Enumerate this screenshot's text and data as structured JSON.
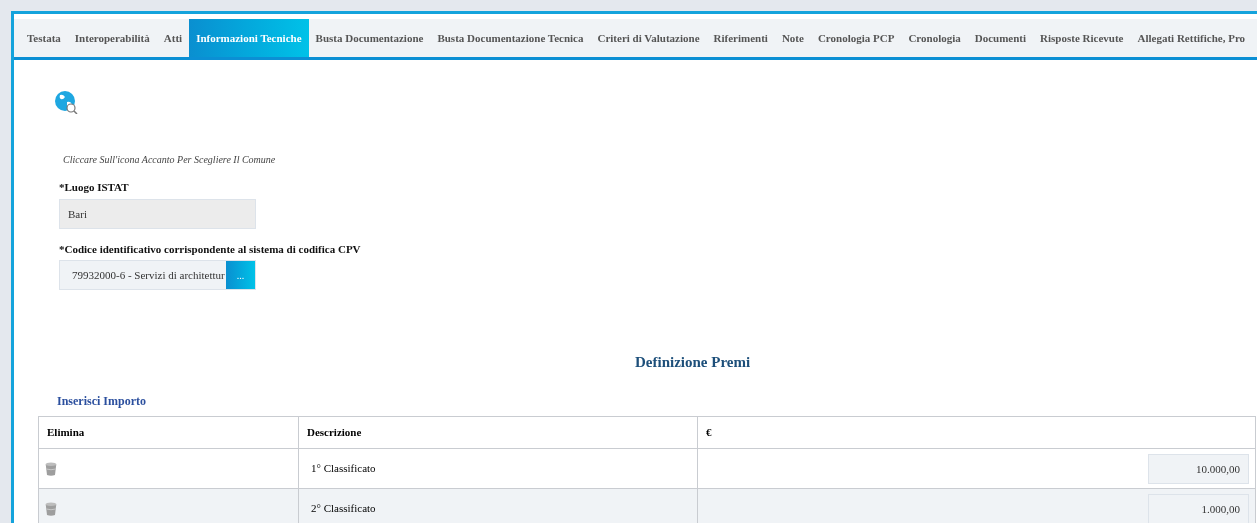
{
  "tabs": [
    {
      "label": "Testata",
      "selected": false
    },
    {
      "label": "Interoperabilità",
      "selected": false
    },
    {
      "label": "Atti",
      "selected": false
    },
    {
      "label": "Informazioni Tecniche",
      "selected": true
    },
    {
      "label": "Busta Documentazione",
      "selected": false
    },
    {
      "label": "Busta Documentazione Tecnica",
      "selected": false
    },
    {
      "label": "Criteri di Valutazione",
      "selected": false
    },
    {
      "label": "Riferimenti",
      "selected": false
    },
    {
      "label": "Note",
      "selected": false
    },
    {
      "label": "Cronologia PCP",
      "selected": false
    },
    {
      "label": "Cronologia",
      "selected": false
    },
    {
      "label": "Documenti",
      "selected": false
    },
    {
      "label": "Risposte Ricevute",
      "selected": false
    },
    {
      "label": "Allegati Rettifiche, Pro",
      "selected": false
    }
  ],
  "hint": "Cliccare Sull'icona Accanto Per Scegliere Il Comune",
  "fields": [
    {
      "label": "*Luogo ISTAT",
      "value": "Bari",
      "kind": "text"
    },
    {
      "label": "*Codice identificativo corrispondente al sistema di codifica CPV",
      "value": "79932000-6 - Servizi di architettur",
      "kind": "picker",
      "button": "..."
    }
  ],
  "section_title": "Definizione Premi",
  "add_link": "Inserisci Importo",
  "table": {
    "columns": [
      "Elimina",
      "Descrizione",
      "€"
    ],
    "rows": [
      {
        "description": "1° Classificato",
        "amount": "10.000,00"
      },
      {
        "description": "2° Classificato",
        "amount": "1.000,00"
      }
    ]
  }
}
